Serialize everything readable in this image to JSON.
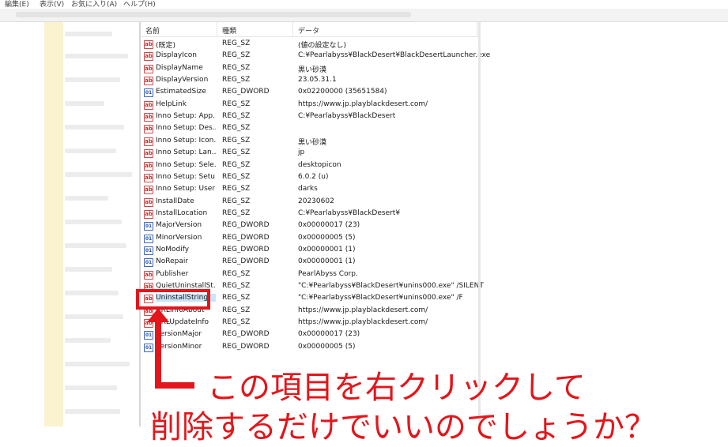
{
  "menubar": {
    "items": [
      "編集(E)",
      "表示(V)",
      "お気に入り(A)",
      "ヘルプ(H)"
    ]
  },
  "columns": {
    "name": "名前",
    "type": "種類",
    "data": "データ"
  },
  "rows": [
    {
      "icon": "string-value-icon",
      "name": "(既定)",
      "type": "REG_SZ",
      "data": "(値の設定なし)"
    },
    {
      "icon": "string-value-icon",
      "name": "DisplayIcon",
      "type": "REG_SZ",
      "data": "C:¥Pearlabyss¥BlackDesert¥BlackDesertLauncher.exe"
    },
    {
      "icon": "string-value-icon",
      "name": "DisplayName",
      "type": "REG_SZ",
      "data": "黒い砂漠"
    },
    {
      "icon": "string-value-icon",
      "name": "DisplayVersion",
      "type": "REG_SZ",
      "data": "23.05.31.1"
    },
    {
      "icon": "dword-value-icon",
      "name": "EstimatedSize",
      "type": "REG_DWORD",
      "data": "0x02200000 (35651584)"
    },
    {
      "icon": "string-value-icon",
      "name": "HelpLink",
      "type": "REG_SZ",
      "data": "https://www.jp.playblackdesert.com/"
    },
    {
      "icon": "string-value-icon",
      "name": "Inno Setup: App...",
      "type": "REG_SZ",
      "data": "C:¥Pearlabyss¥BlackDesert"
    },
    {
      "icon": "string-value-icon",
      "name": "Inno Setup: Des...",
      "type": "REG_SZ",
      "data": ""
    },
    {
      "icon": "string-value-icon",
      "name": "Inno Setup: Icon...",
      "type": "REG_SZ",
      "data": "黒い砂漠"
    },
    {
      "icon": "string-value-icon",
      "name": "Inno Setup: Lan...",
      "type": "REG_SZ",
      "data": "jp"
    },
    {
      "icon": "string-value-icon",
      "name": "Inno Setup: Sele...",
      "type": "REG_SZ",
      "data": "desktopicon"
    },
    {
      "icon": "string-value-icon",
      "name": "Inno Setup: Setu...",
      "type": "REG_SZ",
      "data": "6.0.2 (u)"
    },
    {
      "icon": "string-value-icon",
      "name": "Inno Setup: User",
      "type": "REG_SZ",
      "data": "darks"
    },
    {
      "icon": "string-value-icon",
      "name": "InstallDate",
      "type": "REG_SZ",
      "data": "20230602"
    },
    {
      "icon": "string-value-icon",
      "name": "InstallLocation",
      "type": "REG_SZ",
      "data": "C:¥Pearlabyss¥BlackDesert¥"
    },
    {
      "icon": "dword-value-icon",
      "name": "MajorVersion",
      "type": "REG_DWORD",
      "data": "0x00000017 (23)"
    },
    {
      "icon": "dword-value-icon",
      "name": "MinorVersion",
      "type": "REG_DWORD",
      "data": "0x00000005 (5)"
    },
    {
      "icon": "dword-value-icon",
      "name": "NoModify",
      "type": "REG_DWORD",
      "data": "0x00000001 (1)"
    },
    {
      "icon": "dword-value-icon",
      "name": "NoRepair",
      "type": "REG_DWORD",
      "data": "0x00000001 (1)"
    },
    {
      "icon": "string-value-icon",
      "name": "Publisher",
      "type": "REG_SZ",
      "data": "PearlAbyss Corp."
    },
    {
      "icon": "string-value-icon",
      "name": "QuietUninstallSt...",
      "type": "REG_SZ",
      "data": "\"C:¥Pearlabyss¥BlackDesert¥unins000.exe\" /SILENT"
    },
    {
      "icon": "string-value-icon",
      "name": "UninstallString",
      "type": "REG_SZ",
      "data": "\"C:¥Pearlabyss¥BlackDesert¥unins000.exe\" /F",
      "selected": true
    },
    {
      "icon": "string-value-icon",
      "name": "URLInfoAbout",
      "type": "REG_SZ",
      "data": "https://www.jp.playblackdesert.com/"
    },
    {
      "icon": "string-value-icon",
      "name": "URLUpdateInfo",
      "type": "REG_SZ",
      "data": "https://www.jp.playblackdesert.com/"
    },
    {
      "icon": "dword-value-icon",
      "name": "VersionMajor",
      "type": "REG_DWORD",
      "data": "0x00000017 (23)"
    },
    {
      "icon": "dword-value-icon",
      "name": "VersionMinor",
      "type": "REG_DWORD",
      "data": "0x00000005 (5)"
    }
  ],
  "annotation": {
    "line1": "この項目を右クリックして",
    "line2": "削除するだけでいいのでしょうか？",
    "color": "#e3161b"
  }
}
